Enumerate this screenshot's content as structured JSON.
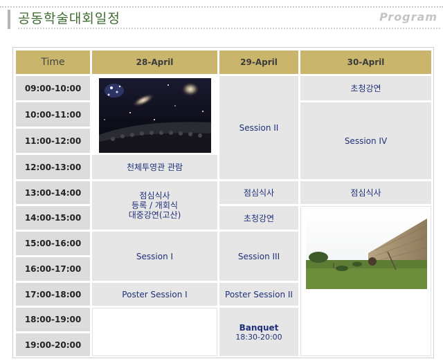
{
  "header": {
    "title": "공동학술대회일정",
    "program_label": "Program"
  },
  "table": {
    "columns": [
      "Time",
      "28-April",
      "29-April",
      "30-April"
    ],
    "times": [
      "09:00-10:00",
      "10:00-11:00",
      "11:00-12:00",
      "12:00-13:00",
      "13:00-14:00",
      "14:00-15:00",
      "15:00-16:00",
      "16:00-17:00",
      "17:00-18:00",
      "18:00-19:00",
      "19:00-20:00"
    ],
    "day1": {
      "planetarium": "천체투영관 관람",
      "lunch_line1": "점심식사",
      "lunch_line2": "등록 / 개회식",
      "lunch_line3": "대중강연(고산)",
      "session1": "Session I",
      "poster1": "Poster Session I"
    },
    "day2": {
      "session2": "Session II",
      "lunch": "점심식사",
      "invited": "초청강연",
      "session3": "Session III",
      "poster2": "Poster Session II",
      "banquet": "Banquet",
      "banquet_time": "18:30-20:00"
    },
    "day3": {
      "invited": "초청강연",
      "session4": "Session IV",
      "lunch": "점심식사"
    }
  },
  "colors": {
    "header_gold": "#c9b56c",
    "time_cell": "#dcdcdc",
    "event_cell": "#e6e6e6",
    "text_blue": "#1f2f7a",
    "title_green": "#3b6a2e"
  }
}
